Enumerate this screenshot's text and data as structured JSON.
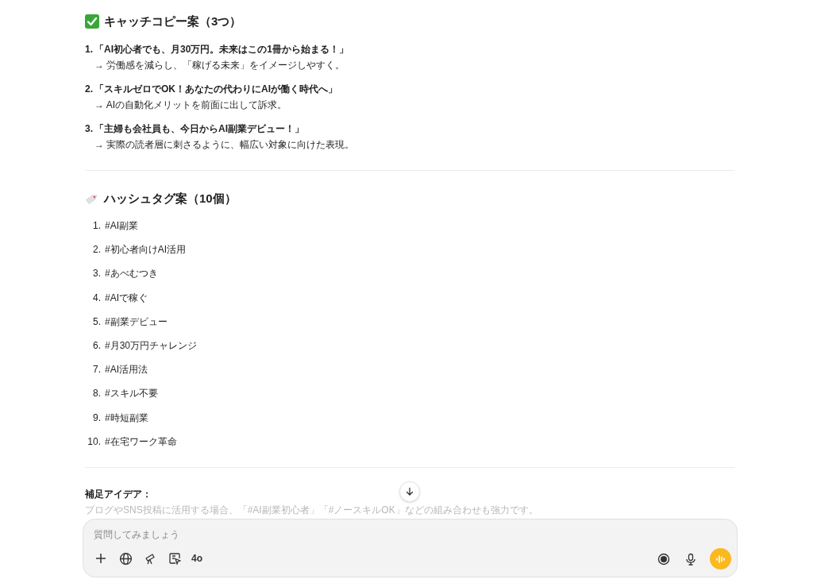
{
  "catchcopy": {
    "heading": "キャッチコピー案（3つ）",
    "items": [
      {
        "number": "1.",
        "headline": "「AI初心者でも、月30万円。未来はこの1冊から始まる！」",
        "note": "→ 労働感を減らし、「稼げる未来」をイメージしやすく。"
      },
      {
        "number": "2.",
        "headline": "「スキルゼロでOK！あなたの代わりにAIが働く時代へ」",
        "note": "→ AIの自動化メリットを前面に出して訴求。"
      },
      {
        "number": "3.",
        "headline": "「主婦も会社員も、今日からAI副業デビュー！」",
        "note": "→ 実際の読者層に刺さるように、幅広い対象に向けた表現。"
      }
    ]
  },
  "hashtags": {
    "heading": "ハッシュタグ案（10個）",
    "items": [
      {
        "number": "1.",
        "text": "#AI副業"
      },
      {
        "number": "2.",
        "text": "#初心者向けAI活用"
      },
      {
        "number": "3.",
        "text": "#あべむつき"
      },
      {
        "number": "4.",
        "text": "#AIで稼ぐ"
      },
      {
        "number": "5.",
        "text": "#副業デビュー"
      },
      {
        "number": "6.",
        "text": "#月30万円チャレンジ"
      },
      {
        "number": "7.",
        "text": "#AI活用法"
      },
      {
        "number": "8.",
        "text": "#スキル不要"
      },
      {
        "number": "9.",
        "text": "#時短副業"
      },
      {
        "number": "10.",
        "text": "#在宅ワーク革命"
      }
    ]
  },
  "supplement": {
    "label": "補足アイデア：",
    "text": "ブログやSNS投稿に活用する場合、「#AI副業初心者」「#ノースキルOK」などの組み合わせも強力です。"
  },
  "composer": {
    "placeholder": "質問してみましょう",
    "model": "4o"
  }
}
